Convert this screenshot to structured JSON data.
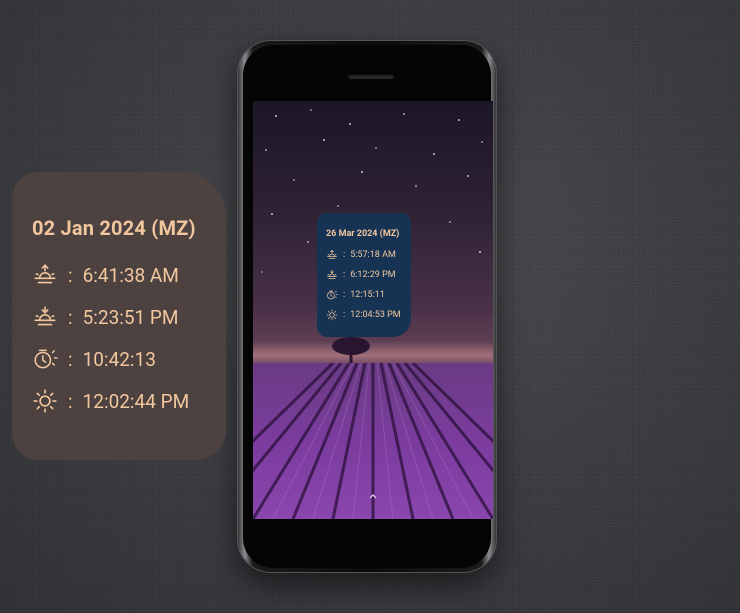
{
  "widget_large": {
    "date": "02 Jan 2024 (MZ)",
    "rows": [
      {
        "icon": "sunrise-icon",
        "sep": ":",
        "value": "6:41:38 AM"
      },
      {
        "icon": "sunset-icon",
        "sep": ":",
        "value": "5:23:51 PM"
      },
      {
        "icon": "day-length-icon",
        "sep": ":",
        "value": "10:42:13"
      },
      {
        "icon": "solar-noon-icon",
        "sep": ":",
        "value": "12:02:44 PM"
      }
    ]
  },
  "widget_small": {
    "date": "26 Mar 2024 (MZ)",
    "rows": [
      {
        "icon": "sunrise-icon",
        "sep": ":",
        "value": "5:57:18 AM"
      },
      {
        "icon": "sunset-icon",
        "sep": ":",
        "value": "6:12:29 PM"
      },
      {
        "icon": "day-length-icon",
        "sep": ":",
        "value": "12:15:11"
      },
      {
        "icon": "solar-noon-icon",
        "sep": ":",
        "value": "12:04:53 PM"
      }
    ]
  },
  "phone": {
    "home_indicator_icon": "chevron-up-icon"
  },
  "colors": {
    "widget_text": "#f2c79e",
    "widget_large_bg": "#4e4240",
    "widget_small_bg": "#163354"
  }
}
